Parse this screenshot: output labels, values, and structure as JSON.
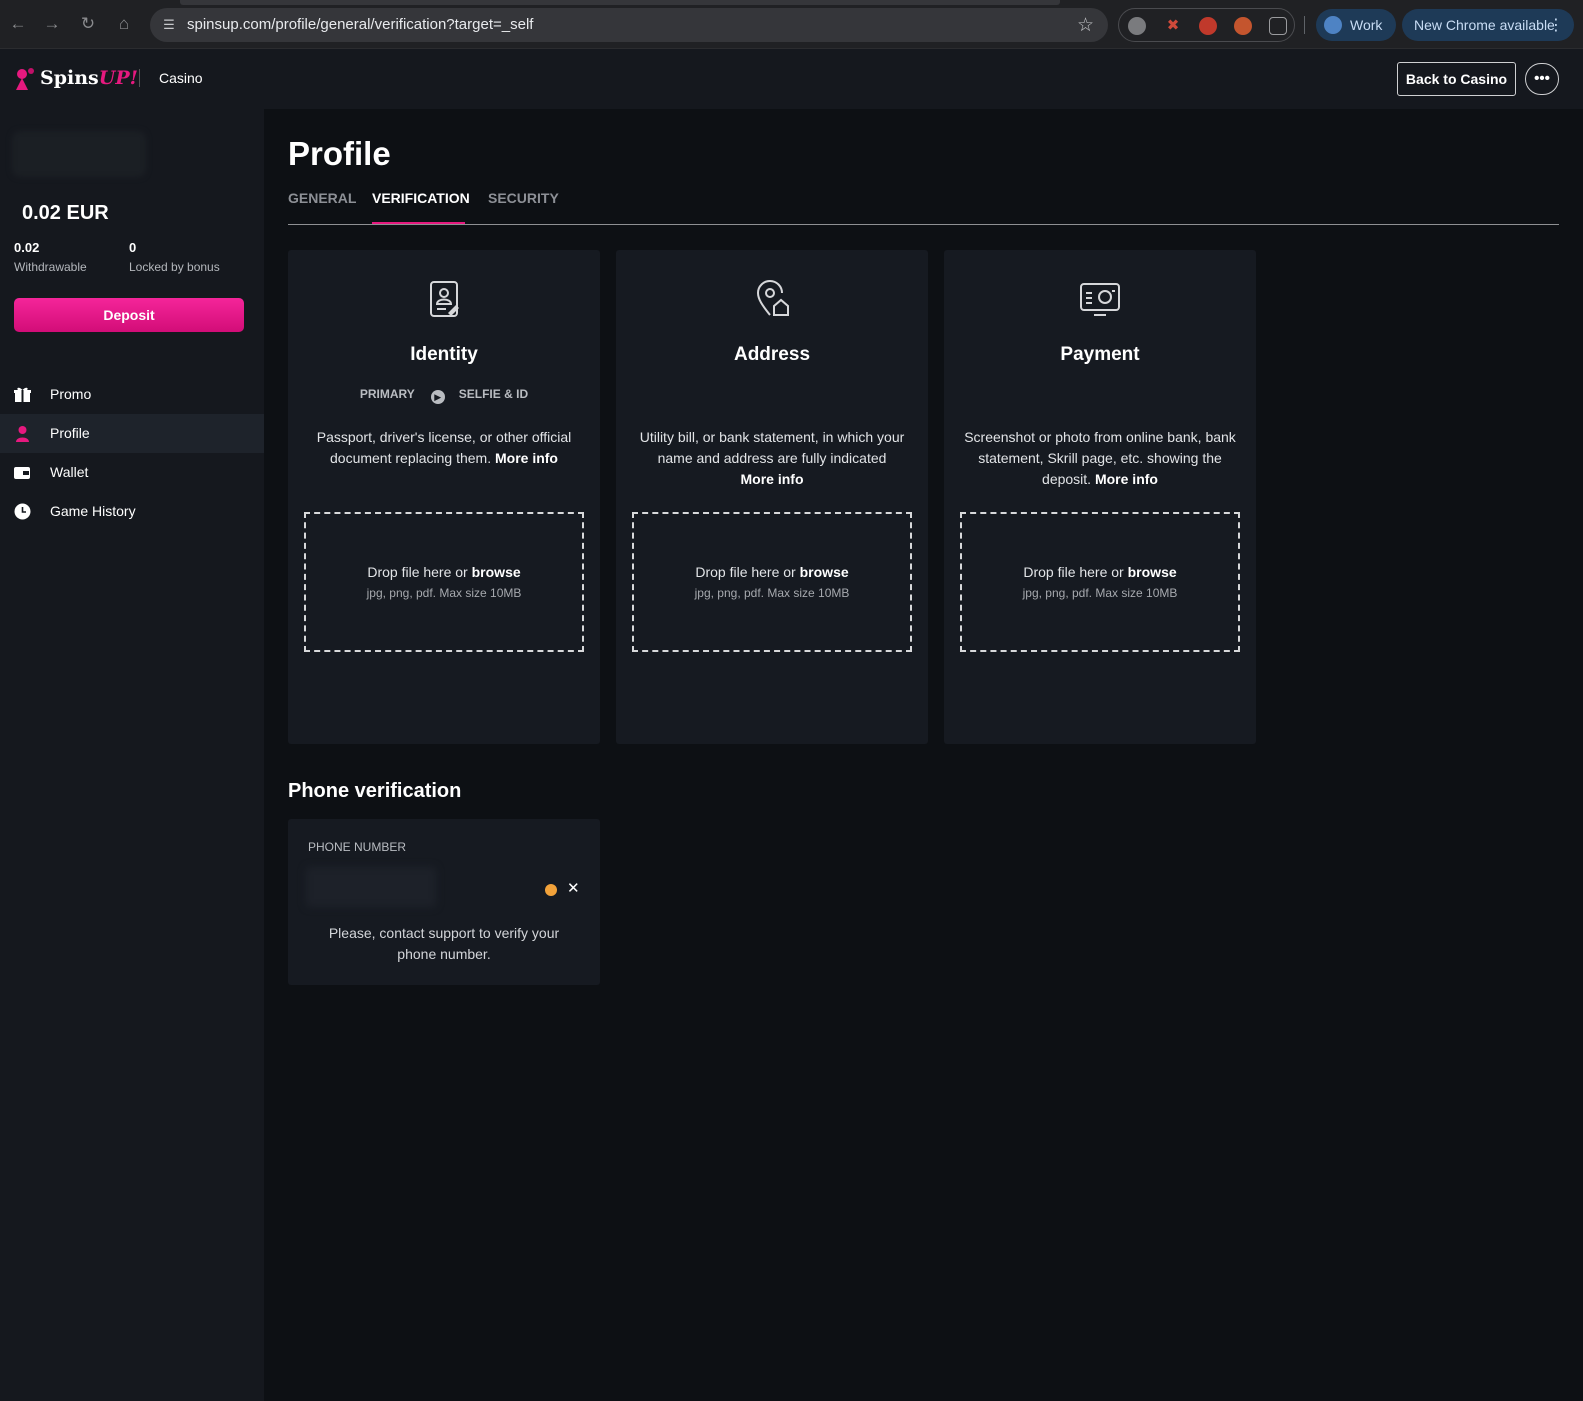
{
  "browser": {
    "url": "spinsup.com/profile/general/verification?target=_self",
    "profile_name": "Work",
    "update_label": "New Chrome available",
    "icons": [
      "back-icon",
      "forward-icon",
      "reload-icon",
      "home-icon",
      "site-settings-icon",
      "bookmark-star-icon",
      "extensions-icon"
    ]
  },
  "header": {
    "brand_main": "Spins",
    "brand_accent": "UP!",
    "section": "Casino",
    "back_button": "Back to Casino",
    "more_button": "•••"
  },
  "sidebar": {
    "balance": "0.02 EUR",
    "withdrawable_value": "0.02",
    "withdrawable_label": "Withdrawable",
    "locked_value": "0",
    "locked_label": "Locked by bonus",
    "deposit_label": "Deposit",
    "items": [
      {
        "label": "Promo",
        "icon": "gift-icon"
      },
      {
        "label": "Profile",
        "icon": "user-icon",
        "active": true
      },
      {
        "label": "Wallet",
        "icon": "wallet-icon"
      },
      {
        "label": "Game History",
        "icon": "clock-icon"
      }
    ]
  },
  "main": {
    "title": "Profile",
    "tabs": [
      {
        "label": "GENERAL"
      },
      {
        "label": "VERIFICATION",
        "active": true
      },
      {
        "label": "SECURITY"
      }
    ],
    "cards": [
      {
        "title": "Identity",
        "icon": "id-card-icon",
        "step_primary": "PRIMARY",
        "step_secondary": "SELFIE & ID",
        "desc": "Passport, driver's license, or other official document replacing them.",
        "more": "More info",
        "drop_text": "Drop file here or",
        "browse": "browse",
        "formats": "jpg, png, pdf. Max size 10MB"
      },
      {
        "title": "Address",
        "icon": "location-home-icon",
        "desc": "Utility bill, or bank statement, in which your name and address are fully indicated",
        "more": "More info",
        "drop_text": "Drop file here or",
        "browse": "browse",
        "formats": "jpg, png, pdf. Max size 10MB"
      },
      {
        "title": "Payment",
        "icon": "payment-screen-icon",
        "desc": "Screenshot or photo from online bank, bank statement, Skrill page, etc. showing the deposit.",
        "more": "More info",
        "drop_text": "Drop file here or",
        "browse": "browse",
        "formats": "jpg, png, pdf. Max size 10MB"
      }
    ],
    "phone": {
      "title": "Phone verification",
      "label": "PHONE NUMBER",
      "message": "Please, contact support to verify your phone number.",
      "status_color": "#f2a23a"
    }
  },
  "colors": {
    "accent": "#e6197f",
    "bg": "#0d1014",
    "panel": "#161a21"
  }
}
